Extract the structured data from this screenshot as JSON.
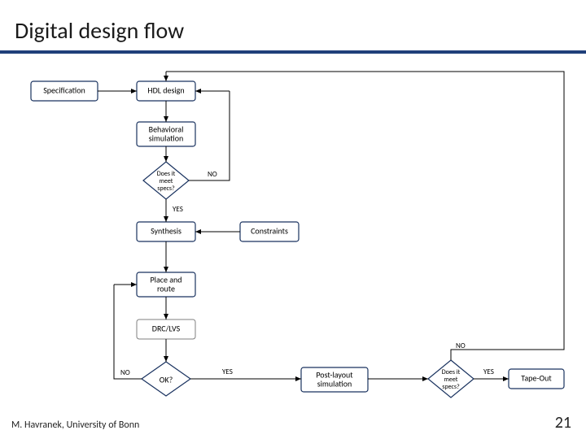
{
  "title": "Digital design flow",
  "footer": {
    "author": "M. Havranek, University of Bonn",
    "page": "21"
  },
  "nodes": {
    "spec": "Specification",
    "hdl": "HDL design",
    "behav_l1": "Behavioral",
    "behav_l2": "simulation",
    "d1_l1": "Does it",
    "d1_l2": "meet",
    "d1_l3": "specs?",
    "synth": "Synthesis",
    "constr": "Constraints",
    "pr_l1": "Place and",
    "pr_l2": "route",
    "drc": "DRC/LVS",
    "ok": "OK?",
    "post_l1": "Post-layout",
    "post_l2": "simulation",
    "d2_l1": "Does it",
    "d2_l2": "meet",
    "d2_l3": "specs?",
    "tape": "Tape-Out"
  },
  "edges": {
    "yes": "YES",
    "no": "NO"
  },
  "chart_data": {
    "type": "diagram",
    "title": "Digital design flow",
    "nodes": [
      {
        "id": "spec",
        "label": "Specification",
        "kind": "process"
      },
      {
        "id": "hdl",
        "label": "HDL design",
        "kind": "process"
      },
      {
        "id": "behav",
        "label": "Behavioral simulation",
        "kind": "process"
      },
      {
        "id": "d1",
        "label": "Does it meet specs?",
        "kind": "decision"
      },
      {
        "id": "synth",
        "label": "Synthesis",
        "kind": "process"
      },
      {
        "id": "constr",
        "label": "Constraints",
        "kind": "process"
      },
      {
        "id": "pr",
        "label": "Place and route",
        "kind": "process"
      },
      {
        "id": "drc",
        "label": "DRC/LVS",
        "kind": "process"
      },
      {
        "id": "ok",
        "label": "OK?",
        "kind": "decision"
      },
      {
        "id": "post",
        "label": "Post-layout simulation",
        "kind": "process"
      },
      {
        "id": "d2",
        "label": "Does it meet specs?",
        "kind": "decision"
      },
      {
        "id": "tape",
        "label": "Tape-Out",
        "kind": "process"
      }
    ],
    "edges": [
      {
        "from": "spec",
        "to": "hdl"
      },
      {
        "from": "hdl",
        "to": "behav"
      },
      {
        "from": "behav",
        "to": "d1"
      },
      {
        "from": "d1",
        "to": "hdl",
        "label": "NO"
      },
      {
        "from": "d1",
        "to": "synth",
        "label": "YES"
      },
      {
        "from": "constr",
        "to": "synth"
      },
      {
        "from": "synth",
        "to": "pr"
      },
      {
        "from": "pr",
        "to": "drc"
      },
      {
        "from": "drc",
        "to": "ok"
      },
      {
        "from": "ok",
        "to": "pr",
        "label": "NO"
      },
      {
        "from": "ok",
        "to": "post",
        "label": "YES"
      },
      {
        "from": "post",
        "to": "d2"
      },
      {
        "from": "d2",
        "to": "hdl",
        "label": "NO"
      },
      {
        "from": "d2",
        "to": "tape",
        "label": "YES"
      }
    ]
  }
}
